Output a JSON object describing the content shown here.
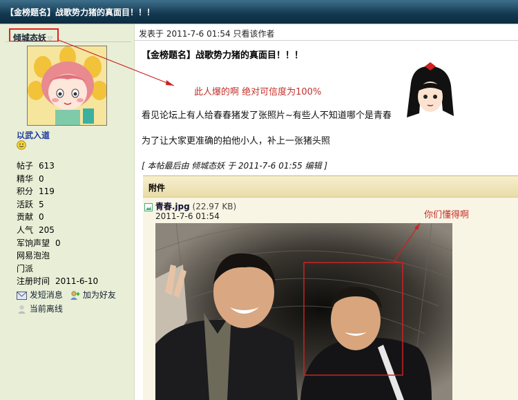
{
  "thread": {
    "title": "【金榜题名】战歌势力猪的真面目！！！"
  },
  "author": {
    "name": "倾城态妖",
    "dropdown": "▽",
    "rank": "以武入道",
    "stats": [
      {
        "label": "帖子",
        "value": "613"
      },
      {
        "label": "精华",
        "value": "0"
      },
      {
        "label": "积分",
        "value": "119"
      },
      {
        "label": "活跃",
        "value": "5"
      },
      {
        "label": "贡献",
        "value": "0"
      },
      {
        "label": "人气",
        "value": "205"
      },
      {
        "label": "军饷声望",
        "value": "0"
      },
      {
        "label": "网易泡泡",
        "value": ""
      },
      {
        "label": "门派",
        "value": ""
      },
      {
        "label": "注册时间",
        "value": "2011-6-10"
      }
    ],
    "actions": {
      "message": "发短消息",
      "add_friend": "加为好友",
      "status": "当前离线"
    }
  },
  "post": {
    "meta": "发表于  2011-7-6 01:54  只看该作者",
    "title": "【金榜题名】战歌势力猪的真面目！！！",
    "red_note": "此人爆的啊  绝对可信度为100%",
    "line1": "看见论坛上有人给春春猪发了张照片~有些人不知道哪个是青春",
    "line2": "为了让大家更准确的拍他小人，补上一张猪头照",
    "edited": "[ 本帖最后由  倾城态妖  于  2011-7-6 01:55  编辑 ]"
  },
  "attachment": {
    "header": "附件",
    "filename": "青春.jpg",
    "size": "(22.97 KB)",
    "date": "2011-7-6 01:54",
    "note": "你们懂得啊"
  },
  "colors": {
    "title_bar": "#13384f",
    "sidebar": "#e9eed7",
    "red_text": "#c4302b",
    "highlight_box": "#cc2222"
  }
}
